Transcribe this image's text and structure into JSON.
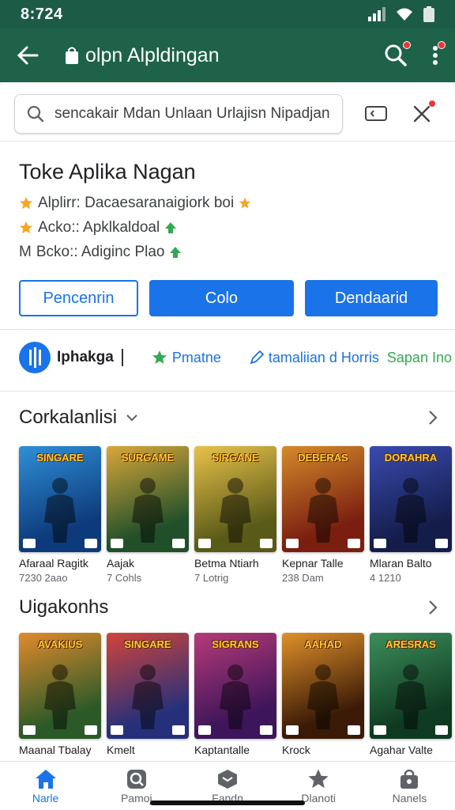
{
  "status": {
    "time": "8:724"
  },
  "appbar": {
    "title": "olpn Alpldingan",
    "back_icon": "arrow-left-icon",
    "search_icon": "search-icon",
    "menu_icon": "more-vert-icon"
  },
  "search": {
    "value": "sencakair Mdan Unlaan Urlajisn Nipadjan"
  },
  "app": {
    "title": "Toke Aplika Nagan",
    "info": [
      {
        "text": "Alplirr: Dacaesaranaigiork boi"
      },
      {
        "text": "Acko:: Apklkaldoal"
      },
      {
        "text": "Bcko:: Adiginc Plao",
        "prefix": "M"
      }
    ]
  },
  "buttons": {
    "outline": "Pencenrin",
    "primary1": "Colo",
    "primary2": "Dendaarid"
  },
  "developer": {
    "name": "Iphakga",
    "chip1": "Pmatne",
    "chip2": "tamaliian d Horris",
    "chip3": "Sapan Ino"
  },
  "section1": {
    "title": "Corkalanlisi",
    "items": [
      {
        "name": "Afaraal Ragitk",
        "sub": "7230 2aao",
        "game_title": "SINGARE",
        "bg1": "#0d3a7a",
        "bg2": "#2f8fd8"
      },
      {
        "name": "Aajak",
        "sub": "7 Cohls",
        "game_title": "SURGAME",
        "bg1": "#204f2a",
        "bg2": "#d9a73a"
      },
      {
        "name": "Betma Ntiarh",
        "sub": "7 Lotrig",
        "game_title": "SIRGANE",
        "bg1": "#5a5a18",
        "bg2": "#e8c24a"
      },
      {
        "name": "Kepnar Talle",
        "sub": "238 Dam",
        "game_title": "DEBERAS",
        "bg1": "#7a1e10",
        "bg2": "#d58a2a"
      },
      {
        "name": "Mlaran Balto",
        "sub": "4 1210",
        "game_title": "DORAHRA",
        "bg1": "#141d4a",
        "bg2": "#3a4bb0"
      }
    ]
  },
  "section2": {
    "title": "Uigakonhs",
    "items": [
      {
        "name": "Maanal Tbalay",
        "game_title": "AVAKIUS",
        "bg1": "#2b5a28",
        "bg2": "#e28a2c"
      },
      {
        "name": "Kmelt",
        "game_title": "SINGARE",
        "bg1": "#26307a",
        "bg2": "#d1443a"
      },
      {
        "name": "Kaptantalle",
        "game_title": "SIGRANS",
        "bg1": "#3d155a",
        "bg2": "#b63a78"
      },
      {
        "name": "Krock",
        "game_title": "AAHAD",
        "bg1": "#3a1a06",
        "bg2": "#e0902a"
      },
      {
        "name": "Agahar Valte",
        "game_title": "ARESRAS",
        "bg1": "#0f3a22",
        "bg2": "#3c8e5a"
      }
    ]
  },
  "nav": [
    {
      "label": "Narle",
      "icon": "home-icon",
      "active": true
    },
    {
      "label": "Pamoj",
      "icon": "search-icon"
    },
    {
      "label": "Fandn",
      "icon": "box-icon"
    },
    {
      "label": "Dlanoti",
      "icon": "star-icon"
    },
    {
      "label": "Nanels",
      "icon": "bag-icon"
    }
  ],
  "colors": {
    "appbar": "#1d6249",
    "accent": "#1a73e8",
    "star": "#f5a623",
    "green": "#34a853"
  }
}
